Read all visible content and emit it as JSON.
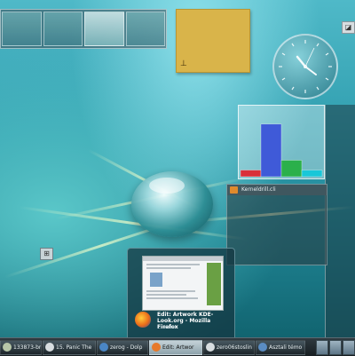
{
  "desktop": {
    "pager_desktops": 4,
    "active_desktop": 3
  },
  "note": {
    "icon": "note-pin-icon"
  },
  "small_button": {
    "glyph": "◪"
  },
  "widget_button": {
    "glyph": "⊞"
  },
  "chart": {
    "bars": [
      {
        "color": "#d9303a",
        "value": 0.1
      },
      {
        "color": "#3f5ad8",
        "value": 0.8
      },
      {
        "color": "#2bb04b",
        "value": 0.25
      },
      {
        "color": "#19c7d8",
        "value": 0.1
      }
    ]
  },
  "dark_window": {
    "title": "Kerneldrill.cli"
  },
  "tooltip": {
    "title": "Edit: Artwork KDE-Look.org - Mozilla Firefox",
    "subtitle": "1. asztal"
  },
  "taskbar": {
    "tasks": [
      {
        "label": "133873-bree",
        "icon_color": "#b7c6a8",
        "active": false
      },
      {
        "label": "15. Panic The",
        "icon_color": "#d8dde0",
        "active": false
      },
      {
        "label": "zerog - Dolp",
        "icon_color": "#4a86c4",
        "active": false
      },
      {
        "label": "Edit: Artwor",
        "icon_color": "#e7792a",
        "active": true
      },
      {
        "label": "zero06stoslin",
        "icon_color": "#d8dde0",
        "active": false
      },
      {
        "label": "Asztali témo",
        "icon_color": "#5a8cc2",
        "active": false
      }
    ]
  }
}
